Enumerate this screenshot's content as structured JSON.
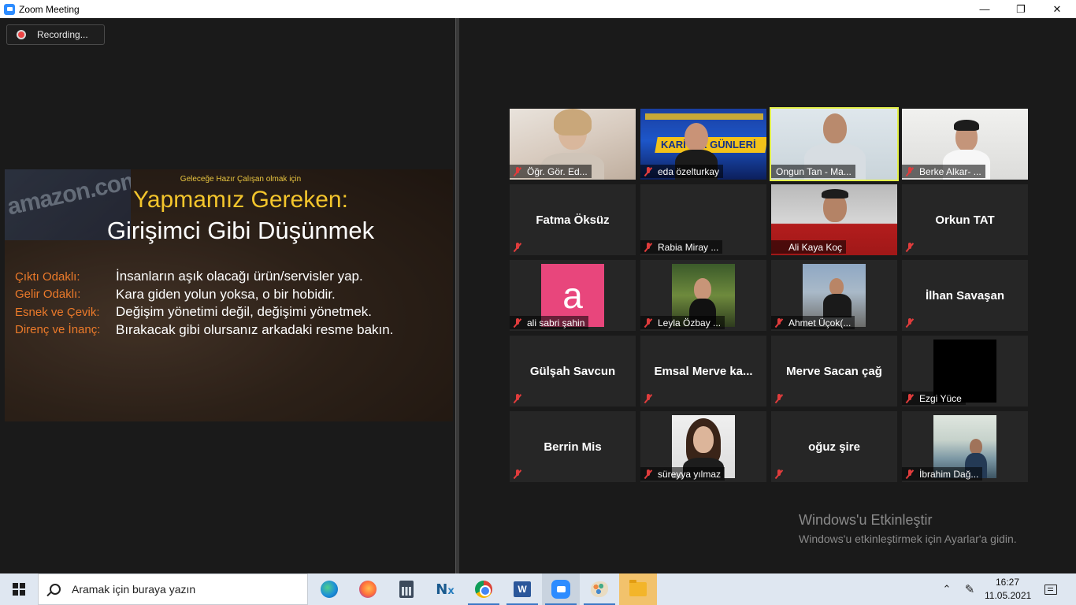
{
  "window": {
    "title": "Zoom Meeting",
    "minimize_icon": "minimize-icon",
    "maximize_icon": "restore-icon",
    "close_icon": "close-icon"
  },
  "recording": {
    "label": "Recording...",
    "icon": "record-dot-icon"
  },
  "slide": {
    "kicker": "Geleceğe Hazır Çalışan olmak için",
    "heading": "Yapmamız Gereken:",
    "subheading": "Girişimci Gibi Düşünmek",
    "background_text": "amazon.com",
    "rows": [
      {
        "key": "Çıktı Odaklı:",
        "value": "İnsanların aşık olacağı ürün/servisler yap."
      },
      {
        "key": "Gelir Odaklı:",
        "value": "Kara giden yolun yoksa, o bir hobidir."
      },
      {
        "key": "Esnek ve Çevik:",
        "value": "Değişim yönetimi değil, değişimi yönetmek."
      },
      {
        "key": "Direnç ve İnanç:",
        "value": "Bırakacak gibi olursanız arkadaki resme bakın."
      }
    ],
    "colors": {
      "heading": "#f3c52c",
      "keys": "#ec7a2a"
    }
  },
  "participants": [
    {
      "name": "Öğr. Gör. Ed...",
      "type": "video"
    },
    {
      "name": "eda özelturkay",
      "type": "video",
      "video_text": "KARİYER GÜNLERİ"
    },
    {
      "name": "Ongun Tan - Ma...",
      "type": "video",
      "active_speaker": true
    },
    {
      "name": "Berke Alkar- ...",
      "type": "video"
    },
    {
      "name": "Fatma Öksüz",
      "type": "name_only",
      "display": "Fatma Öksüz"
    },
    {
      "name": "Rabia Miray ...",
      "type": "blank"
    },
    {
      "name": "Ali Kaya Koç",
      "type": "video"
    },
    {
      "name": "Orkun TAT",
      "type": "name_only",
      "display": "Orkun TAT"
    },
    {
      "name": "ali sabri şahin",
      "type": "avatar",
      "letter": "a"
    },
    {
      "name": "Leyla Özbay ...",
      "type": "photo"
    },
    {
      "name": "Ahmet Üçok(...",
      "type": "photo"
    },
    {
      "name": "İlhan Savaşan",
      "type": "name_only",
      "display": "İlhan Savaşan"
    },
    {
      "name": "Gülşah Savcun",
      "type": "name_only",
      "display": "Gülşah Savcun"
    },
    {
      "name": "Emsal Merve ka...",
      "type": "name_only",
      "display": "Emsal Merve ka..."
    },
    {
      "name": "Merve Sacan çağ",
      "type": "name_only",
      "display": "Merve Sacan çağ"
    },
    {
      "name": "Ezgi Yüce",
      "type": "photo_black"
    },
    {
      "name": "Berrin Mis",
      "type": "name_only",
      "display": "Berrin Mis"
    },
    {
      "name": "süreyya yılmaz",
      "type": "photo"
    },
    {
      "name": "oğuz şire",
      "type": "name_only",
      "display": "oğuz şire"
    },
    {
      "name": "İbrahim Dağ...",
      "type": "photo"
    }
  ],
  "watermark": {
    "line1": "Windows'u Etkinleştir",
    "line2": "Windows'u etkinleştirmek için Ayarlar'a gidin."
  },
  "taskbar": {
    "search_placeholder": "Aramak için buraya yazın",
    "apps": [
      "edge-icon",
      "firefox-icon",
      "calculator-icon",
      "nx-icon",
      "chrome-icon",
      "word-icon",
      "zoom-icon",
      "paint-icon",
      "file-explorer-icon"
    ],
    "time": "16:27",
    "date": "11.05.2021"
  }
}
